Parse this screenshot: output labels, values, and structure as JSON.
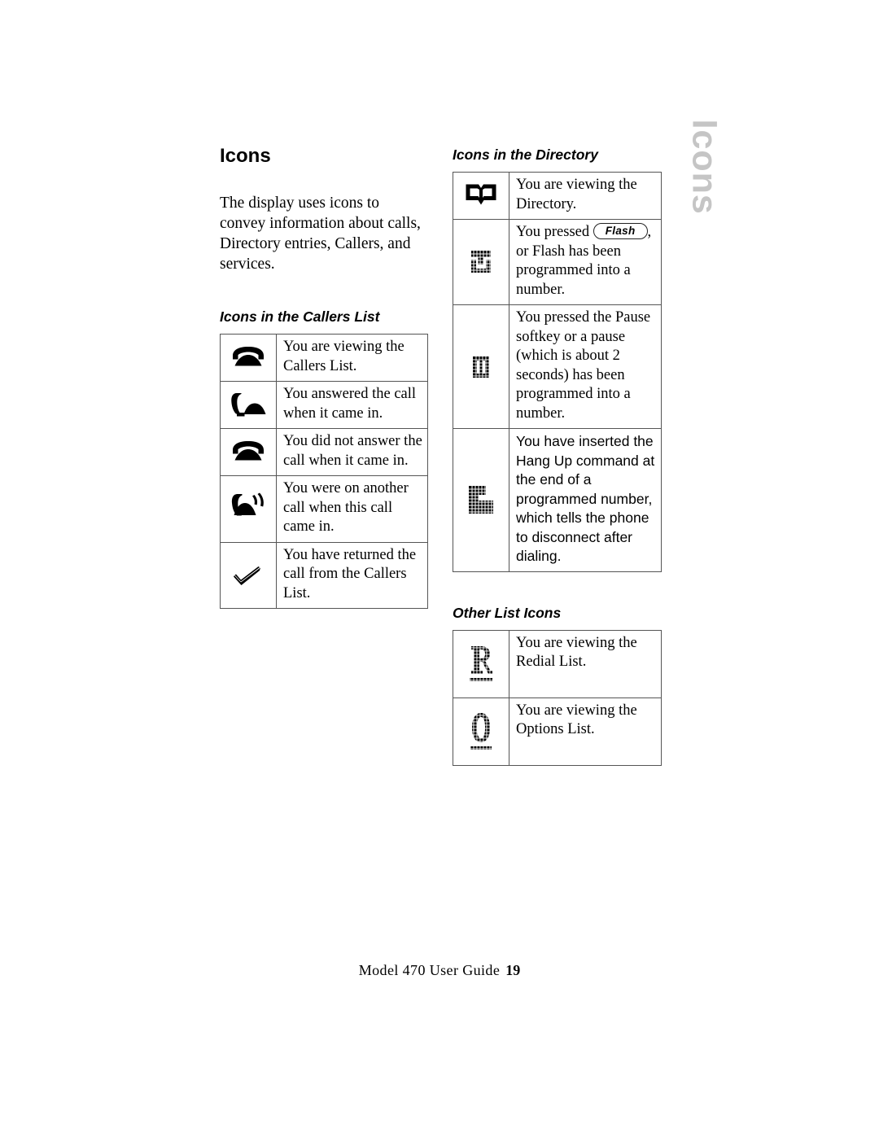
{
  "page": {
    "title": "Icons",
    "intro": "The display uses icons to convey information about calls, Directory entries, Callers, and services.",
    "side_tab_label": "Icons",
    "side_tab_color": "#c5c5c5"
  },
  "footer": {
    "guide": "Model 470 User Guide",
    "page_number": "19"
  },
  "sections": {
    "callers_list": {
      "heading": "Icons in the Callers List",
      "rows": [
        {
          "icon": "phone-on-hook-icon",
          "text": "You are viewing the Callers List."
        },
        {
          "icon": "phone-answered-icon",
          "text": "You answered the call when it came in."
        },
        {
          "icon": "phone-missed-icon",
          "text": "You did not answer the call when it came in."
        },
        {
          "icon": "phone-ringing-busy-icon",
          "text": "You were on another call when this call came in."
        },
        {
          "icon": "checkmark-icon",
          "text": "You have returned the call from the Callers List."
        }
      ]
    },
    "directory": {
      "heading": "Icons in the Directory",
      "rows": [
        {
          "icon": "open-book-icon",
          "text": "You are viewing the Directory."
        },
        {
          "icon": "flash-block-icon",
          "text_before": "You pressed ",
          "button_label": "Flash",
          "text_after": ", or Flash has been programmed into a number."
        },
        {
          "icon": "pause-block-icon",
          "text": "You pressed the Pause softkey or a pause (which is about 2 seconds) has been programmed into a number."
        },
        {
          "icon": "hangup-block-icon",
          "text": "You have inserted the Hang Up command at the end of a programmed number, which tells the phone to disconnect after dialing."
        }
      ]
    },
    "other_list": {
      "heading": "Other List Icons",
      "rows": [
        {
          "icon": "letter-r-icon",
          "text": "You are viewing the Redial List."
        },
        {
          "icon": "letter-o-icon",
          "text": "You are viewing the Options List."
        }
      ]
    }
  }
}
